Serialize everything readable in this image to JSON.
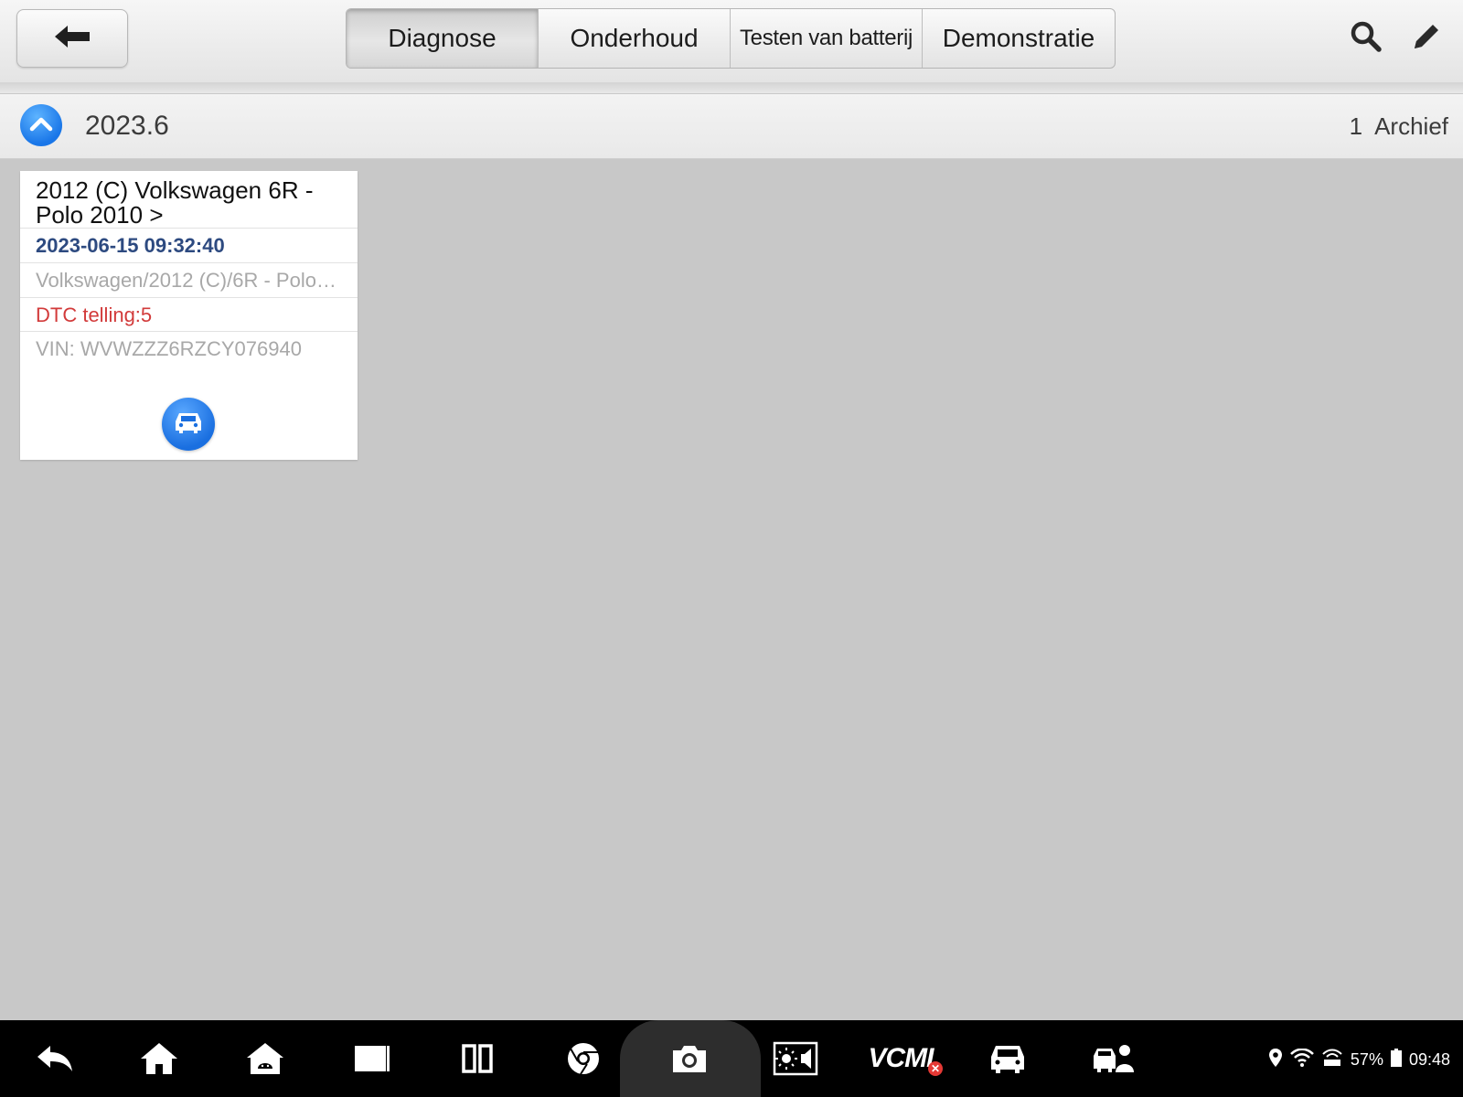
{
  "toolbar": {
    "tabs": [
      {
        "label": "Diagnose",
        "active": true
      },
      {
        "label": "Onderhoud",
        "active": false
      },
      {
        "label": "Testen van batterij",
        "active": false
      },
      {
        "label": "Demonstratie",
        "active": false
      }
    ],
    "icons": [
      "back-arrow-icon",
      "search-icon",
      "edit-pencil-icon"
    ]
  },
  "group": {
    "title": "2023.6",
    "count": "1",
    "count_label": "Archief"
  },
  "records": [
    {
      "title": "2012 (C) Volkswagen 6R - Polo  2010 >",
      "date": "2023-06-15 09:32:40",
      "path": "Volkswagen/2012 (C)/6R - Polo…",
      "dtc": "DTC telling:5",
      "vin": "VIN: WVWZZZ6RZCY076940"
    }
  ],
  "navbar": {
    "icons": [
      "back-icon",
      "home-icon",
      "android-home-icon",
      "window-icon",
      "split-screen-icon",
      "chrome-icon",
      "camera-icon",
      "brightness-volume-icon",
      "vcm-icon",
      "car-icon",
      "technician-car-icon"
    ],
    "vcm_label": "VCMI"
  },
  "status": {
    "battery": "57%",
    "time": "09:48"
  },
  "colors": {
    "accent_blue": "#1976e8",
    "date_text": "#2d4a80",
    "dtc_red": "#d23a3a",
    "background": "#c8c8c8"
  }
}
